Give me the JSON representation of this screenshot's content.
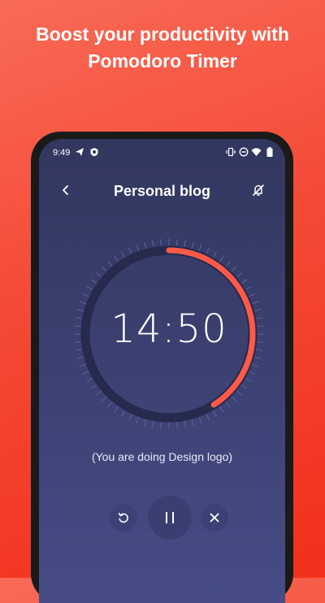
{
  "promo": {
    "headline_line1": "Boost your productivity with",
    "headline_line2": "Pomodoro Timer"
  },
  "status_bar": {
    "time": "9:49",
    "left_icons": [
      "send-icon",
      "shield-icon"
    ],
    "right_icons": [
      "vibrate-icon",
      "do-not-disturb-icon",
      "wifi-icon",
      "battery-icon"
    ]
  },
  "app_bar": {
    "back_icon": "chevron-left-icon",
    "title": "Personal blog",
    "mute_icon": "bell-off-icon"
  },
  "timer": {
    "remaining": "14:50",
    "progress": 0.41,
    "track_color": "#262a4c",
    "progress_color": "#ff5a47",
    "tick_color": "#5a5f90"
  },
  "task_text": "(You are doing Design logo)",
  "controls": {
    "reset_icon": "restart-icon",
    "pause_icon": "pause-icon",
    "stop_icon": "close-icon"
  },
  "colors": {
    "accent": "#ff5a47",
    "background_top": "#32375f",
    "background_bottom": "#474c86"
  }
}
